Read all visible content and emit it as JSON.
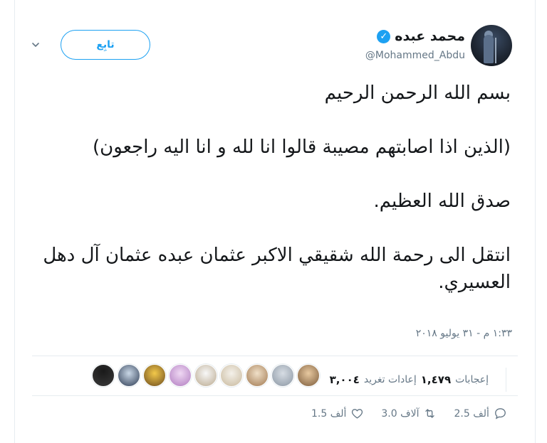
{
  "header": {
    "name": "محمد عبده",
    "handle": "@Mohammed_Abdu",
    "follow_label": "تابِع"
  },
  "tweet": {
    "paragraphs": [
      "بسم الله الرحمن الرحيم",
      "(الذين اذا اصابتهم مصيبة قالوا انا لله و انا اليه راجعون)",
      "صدق الله العظيم.",
      "انتقل الى رحمة الله شقيقي الاكبر عثمان عبده عثمان آل دهل العسيري."
    ],
    "timestamp": "١:٣٣ م - ٣١ يوليو ٢٠١٨"
  },
  "stats": {
    "retweets_count": "٣,٠٠٤",
    "retweets_label": "إعادات تغريد",
    "likes_count": "١,٤٧٩",
    "likes_label": "إعجابات"
  },
  "actions": {
    "reply": "2.5 ألف",
    "retweet": "3.0 آلاف",
    "like": "1.5 ألف"
  },
  "colors": {
    "accent": "#1da1f2",
    "muted": "#657786",
    "text": "#14171a",
    "border": "#e6ecf0"
  },
  "icons": [
    "verified-badge-icon",
    "chevron-down-icon",
    "reply-icon",
    "retweet-icon",
    "heart-icon"
  ]
}
